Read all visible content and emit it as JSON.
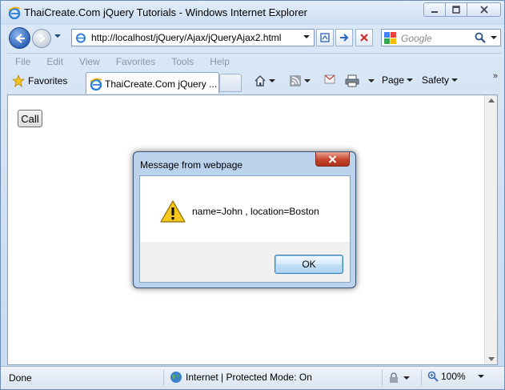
{
  "window": {
    "title": "ThaiCreate.Com jQuery Tutorials - Windows Internet Explorer"
  },
  "address_bar": {
    "url": "http://localhost/jQuery/Ajax/jQueryAjax2.html"
  },
  "search": {
    "placeholder": "Google"
  },
  "menu": {
    "items": [
      "File",
      "Edit",
      "View",
      "Favorites",
      "Tools",
      "Help"
    ]
  },
  "favorites_bar": {
    "favorites_label": "Favorites",
    "tab_label": "ThaiCreate.Com jQuery ...",
    "page_label": "Page",
    "safety_label": "Safety"
  },
  "page": {
    "call_button_label": "Call"
  },
  "dialog": {
    "title": "Message from webpage",
    "message": "name=John , location=Boston",
    "ok_label": "OK"
  },
  "status_bar": {
    "status": "Done",
    "zone": "Internet | Protected Mode: On",
    "zoom": "100%"
  },
  "colors": {
    "frame": "#c7daf0",
    "dialog_border": "#3a5478",
    "close_red": "#c8452f"
  }
}
